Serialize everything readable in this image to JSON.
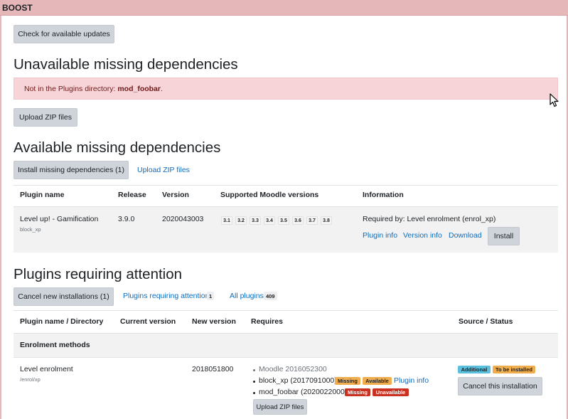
{
  "header": {
    "title": "BOOST"
  },
  "buttons": {
    "check_updates": "Check for available updates",
    "upload_zip_1": "Upload ZIP files",
    "install_missing": "Install missing dependencies (1)",
    "install": "Install",
    "cancel_new": "Cancel new installations (1)",
    "cancel_this": "Cancel this installation",
    "upload_zip_small": "Upload ZIP files"
  },
  "unavailable": {
    "heading": "Unavailable missing dependencies",
    "alert_prefix": "Not in the Plugins directory: ",
    "alert_plugin": "mod_foobar",
    "alert_suffix": "."
  },
  "available": {
    "heading": "Available missing dependencies",
    "upload_link": "Upload ZIP files",
    "columns": [
      "Plugin name",
      "Release",
      "Version",
      "Supported Moodle versions",
      "Information"
    ],
    "row": {
      "name": "Level up! - Gamification",
      "component": "block_xp",
      "release": "3.9.0",
      "version": "2020043003",
      "moodle_versions": [
        "3.1",
        "3.2",
        "3.3",
        "3.4",
        "3.5",
        "3.6",
        "3.7",
        "3.8"
      ],
      "required_by": "Required by: Level enrolment (enrol_xp)",
      "links": [
        "Plugin info",
        "Version info",
        "Download"
      ]
    }
  },
  "attention": {
    "heading": "Plugins requiring attention",
    "tab_attention": "Plugins requiring attention",
    "tab_attention_count": "1",
    "tab_all": "All plugins",
    "tab_all_count": "409",
    "columns": [
      "Plugin name / Directory",
      "Current version",
      "New version",
      "Requires",
      "Source / Status"
    ],
    "group": "Enrolment methods",
    "row": {
      "name": "Level enrolment",
      "directory": "/enrol/xp",
      "new_version": "2018051800",
      "requires": [
        {
          "text": "Moodle 2016052300"
        },
        {
          "text": "block_xp (2017091000)",
          "badges": [
            "Missing",
            "Available"
          ],
          "link": "Plugin info"
        },
        {
          "text": "mod_foobar (2020022000)",
          "badges": [
            "Missing",
            "Unavailable"
          ]
        }
      ],
      "status_badges": [
        "Additional",
        "To be installed"
      ]
    }
  },
  "colors": {
    "danger": "#ca3120",
    "warning": "#f0ad4e",
    "info": "#5bc0de",
    "link": "#0f6cbf"
  }
}
